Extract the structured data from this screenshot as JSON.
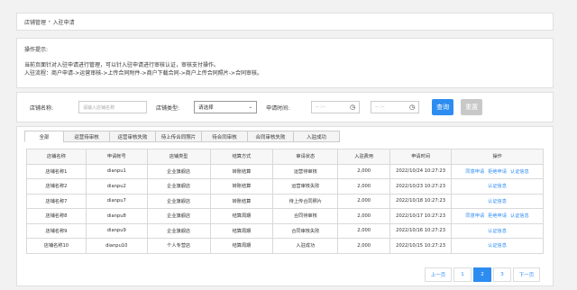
{
  "breadcrumb": {
    "parent": "店铺管理",
    "sep": "•",
    "current": "入驻申请"
  },
  "tips": {
    "title": "操作提示:",
    "line1": "当前页面针对入驻申请进行管理，可以针入驻申请进行审核认证，审核支付操作。",
    "line2": "入驻流程：商户申请->运营审核->上传合同附件->商户下载合同->商户上传合同照片->合同审核。"
  },
  "filter": {
    "shop_name_label": "店铺名称:",
    "shop_name_placeholder": "请输入店铺名称",
    "shop_type_label": "店铺类型:",
    "shop_type_value": "请选择",
    "apply_time_label": "申请时间:",
    "date_from": "-- :--",
    "date_to": "-- :--",
    "query_label": "查询",
    "reset_label": "重置"
  },
  "tabs": [
    "全部",
    "运营待审核",
    "运营审核失败",
    "待上传合同照片",
    "待合同审核",
    "合同审核失败",
    "入驻成功"
  ],
  "table": {
    "headers": [
      "店铺名称",
      "申请帐号",
      "店铺类型",
      "结算方式",
      "审请状态",
      "入驻费用",
      "申请时间",
      "操作"
    ],
    "rows": [
      {
        "name": "店铺名称1",
        "account": "dianpu1",
        "type": "企业旗舰店",
        "settle": "转账结算",
        "status": "运营待审核",
        "fee": "2,000",
        "time": "2022/10/24 10:27:23",
        "ops": [
          "同意申请",
          "拒绝申请",
          "认证信息"
        ]
      },
      {
        "name": "店铺名称2",
        "account": "dianpu2",
        "type": "企业旗舰店",
        "settle": "转账结算",
        "status": "运营审核失败",
        "fee": "2,000",
        "time": "2022/10/23 10:27:23",
        "ops": [
          "认证信息"
        ]
      },
      {
        "name": "店铺名称7",
        "account": "dianpu7",
        "type": "企业旗舰店",
        "settle": "转账结算",
        "status": "待上传合同照片",
        "fee": "2,000",
        "time": "2022/10/18 10:27:23",
        "ops": [
          "认证信息"
        ]
      },
      {
        "name": "店铺名称8",
        "account": "dianpu8",
        "type": "企业旗舰店",
        "settle": "结算周期",
        "status": "合同待审核",
        "fee": "2,000",
        "time": "2022/10/17 10:27:23",
        "ops": [
          "同意申请",
          "拒绝申请",
          "认证信息"
        ]
      },
      {
        "name": "店铺名称9",
        "account": "dianpu9",
        "type": "企业旗舰店",
        "settle": "结算周期",
        "status": "合同审核失败",
        "fee": "2,000",
        "time": "2022/10/16 10:27:23",
        "ops": [
          "认证信息"
        ]
      },
      {
        "name": "店铺名称10",
        "account": "dianpu10",
        "type": "个人专营店",
        "settle": "结算周期",
        "status": "入驻成功",
        "fee": "2,000",
        "time": "2022/10/15 10:27:23",
        "ops": [
          "认证信息"
        ]
      }
    ]
  },
  "pagination": {
    "prev": "上一页",
    "pages": [
      "1",
      "2",
      "3"
    ],
    "current": "2",
    "next": "下一页"
  }
}
